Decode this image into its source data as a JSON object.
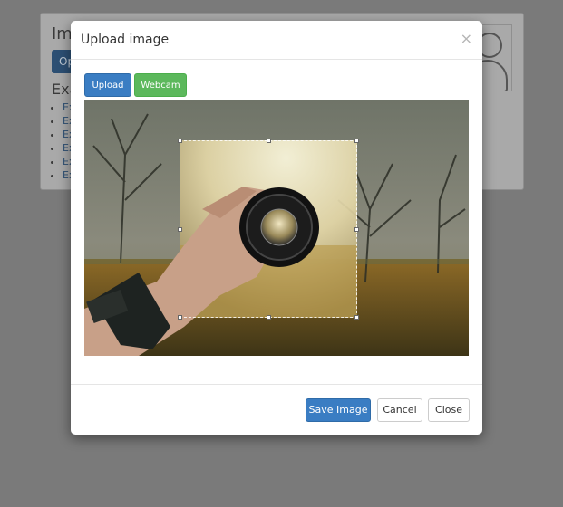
{
  "background": {
    "title": "Ima",
    "button_label": "Op",
    "subtitle": "Exa",
    "list_items": [
      "Ex",
      "Ex",
      "Ex",
      "Ex",
      "Ex",
      "Ex"
    ]
  },
  "modal": {
    "title": "Upload image",
    "close_glyph": "×",
    "tabs": {
      "upload_label": "Upload",
      "webcam_label": "Webcam"
    },
    "footer": {
      "save_label": "Save Image",
      "cancel_label": "Cancel",
      "close_label": "Close"
    }
  },
  "colors": {
    "primary": "#3a7dc3",
    "success": "#5cb85c",
    "overlay": "#7a7a7a"
  }
}
